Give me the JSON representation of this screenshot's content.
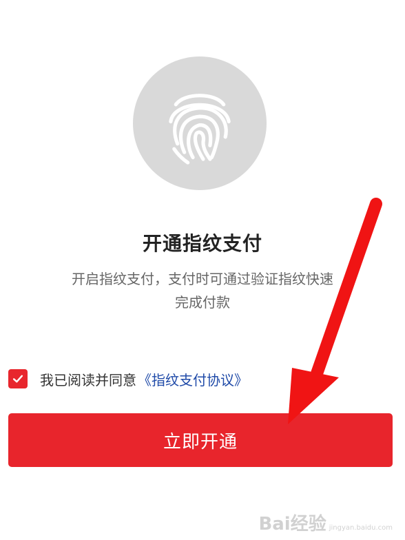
{
  "title": "开通指纹支付",
  "description_line1": "开启指纹支付，支付时可通过验证指纹快速",
  "description_line2": "完成付款",
  "agreement": {
    "prefix": "我已阅读并同意",
    "link_text": "《指纹支付协议》",
    "checked": true
  },
  "primary_button": "立即开通",
  "watermark": {
    "brand": "Bai经验",
    "url": "jingyan.baidu.com"
  },
  "colors": {
    "accent": "#e8252c",
    "link": "#1f4aa8",
    "icon_bg": "#d9d9d9"
  },
  "icons": {
    "hero": "fingerprint-icon",
    "check": "check-icon",
    "annotation": "red-arrow-icon"
  }
}
